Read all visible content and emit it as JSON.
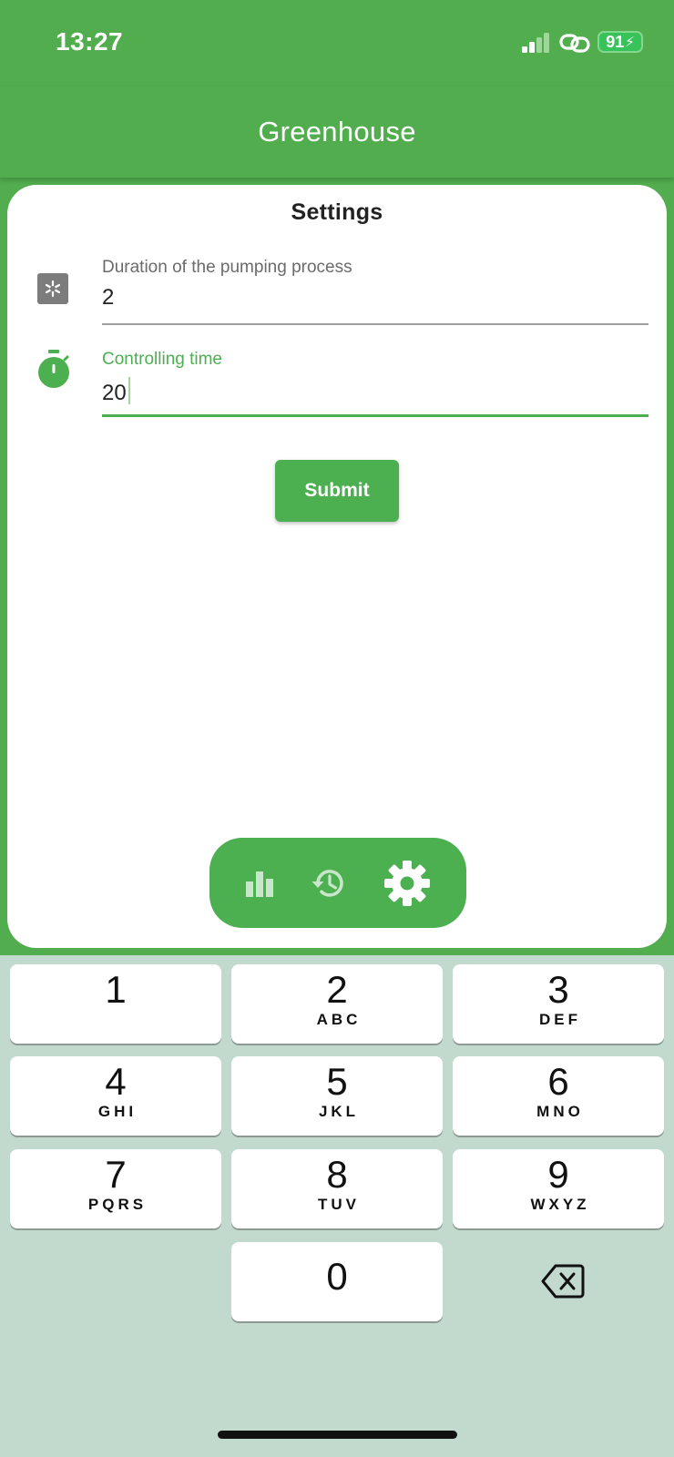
{
  "status_bar": {
    "time": "13:27",
    "battery": "91"
  },
  "header": {
    "title": "Greenhouse"
  },
  "settings": {
    "title": "Settings",
    "fields": [
      {
        "label": "Duration of the pumping process",
        "value": "2",
        "icon": "snowflake-square-icon"
      },
      {
        "label": "Controlling time",
        "value": "20",
        "icon": "stopwatch-icon"
      }
    ],
    "submit_label": "Submit"
  },
  "nav": [
    {
      "icon": "bar-chart-icon",
      "active": false
    },
    {
      "icon": "history-icon",
      "active": false
    },
    {
      "icon": "gear-icon",
      "active": true
    }
  ],
  "keyboard": {
    "keys": [
      {
        "digit": "1",
        "letters": ""
      },
      {
        "digit": "2",
        "letters": "ABC"
      },
      {
        "digit": "3",
        "letters": "DEF"
      },
      {
        "digit": "4",
        "letters": "GHI"
      },
      {
        "digit": "5",
        "letters": "JKL"
      },
      {
        "digit": "6",
        "letters": "MNO"
      },
      {
        "digit": "7",
        "letters": "PQRS"
      },
      {
        "digit": "8",
        "letters": "TUV"
      },
      {
        "digit": "9",
        "letters": "WXYZ"
      },
      {
        "digit": "0",
        "letters": ""
      }
    ],
    "backspace_icon": "backspace-icon"
  },
  "colors": {
    "primary": "#4caf50",
    "app_background": "#51ad4e",
    "keyboard_background": "#c2dace",
    "nav_inactive": "#c8e6c9"
  }
}
